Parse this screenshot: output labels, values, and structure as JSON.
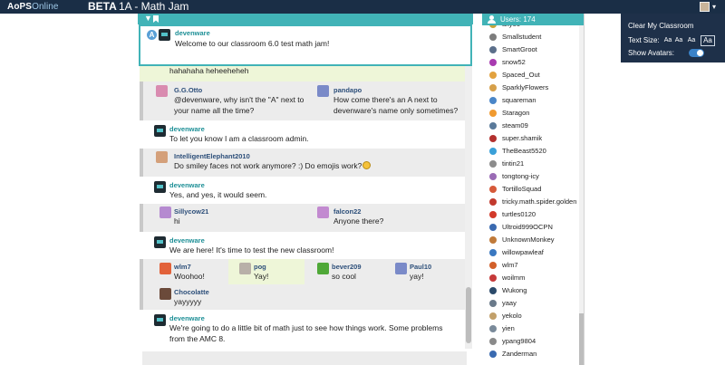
{
  "topbar": {
    "logo_brand": "AoPS",
    "logo_suffix": "Online",
    "beta": "BETA",
    "title": "1A - Math Jam"
  },
  "pinned": {
    "badge": "A",
    "user": "devenware",
    "text": "Welcome to our classroom 6.0 test math jam!"
  },
  "messages": {
    "partial_top": "hahahaha heheeheheh",
    "r1": {
      "a_user": "G.G.Otto",
      "a_text1": "@devenware, why isn't the \"A\" next to",
      "a_text2": "your name all the time?",
      "b_user": "pandapo",
      "b_text1": "How come there's an A next to",
      "b_text2": "devenware's name only sometimes?"
    },
    "r2": {
      "user": "devenware",
      "text": "To let you know I am a classroom admin."
    },
    "r3": {
      "user": "IntelligentElephant2010",
      "text": "Do smiley faces not work anymore? :) Do emojis work?"
    },
    "r4": {
      "user": "devenware",
      "text": "Yes, and yes, it would seem."
    },
    "r5": {
      "a_user": "Sillycow21",
      "a_text": "hi",
      "b_user": "falcon22",
      "b_text": "Anyone there?"
    },
    "r6": {
      "user": "devenware",
      "text": "We are here! It's time to test the new classroom!"
    },
    "r7": {
      "a_user": "wlm7",
      "a_text": "Woohoo!",
      "b_user": "pog",
      "b_text": "Yay!",
      "c_user": "bever209",
      "c_text": "so cool",
      "d_user": "Paul10",
      "d_text": "yay!",
      "e_user": "Chocolatte",
      "e_text": "yayyyyy"
    },
    "r8": {
      "user": "devenware",
      "text": "We're going to do a little bit of math just to see how things work. Some problems from the AMC 8."
    }
  },
  "users": {
    "count_label": "Users: 174",
    "list": [
      "akyoo",
      "Smallstudent",
      "SmartGroot",
      "snow52",
      "Spaced_Out",
      "SparklyFlowers",
      "squareman",
      "Staragon",
      "steam09",
      "super.shamik",
      "TheBeast5520",
      "tintin21",
      "tongtong-icy",
      "TortilloSquad",
      "tricky.math.spider.golden",
      "turtles0120",
      "Ultroid999OCPN",
      "UnknownMonkey",
      "willowpawleaf",
      "wlm7",
      "woilmm",
      "Wukong",
      "yaay",
      "yekolo",
      "yien",
      "ypang9804",
      "Zanderman"
    ],
    "colors": [
      "#c7a43a",
      "#7d7d7d",
      "#5b6f8a",
      "#a83bb0",
      "#e2a23f",
      "#d6a04a",
      "#4a86c8",
      "#f09a30",
      "#5a7a9a",
      "#b3302e",
      "#3aa0d8",
      "#8c8c8c",
      "#9a6bb5",
      "#d65a3a",
      "#c23a2e",
      "#d23a2a",
      "#3a6ab0",
      "#c07a3a",
      "#3a78c0",
      "#d2602a",
      "#c63a3a",
      "#2b4a6a",
      "#6a7a8a",
      "#c2a06a",
      "#7a8a9a",
      "#8a8a8a",
      "#3a6ab0"
    ]
  },
  "settings": {
    "clear": "Clear My Classroom",
    "text_size_label": "Text Size:",
    "size_options": [
      "Aa",
      "Aa",
      "Aa",
      "Aa"
    ],
    "avatars_label": "Show Avatars:",
    "avatars_on": true
  },
  "colors": {
    "accent": "#41b3b7",
    "navbar": "#1a2e46",
    "username": "#2d4f7a",
    "admin_username": "#1d8f96"
  }
}
